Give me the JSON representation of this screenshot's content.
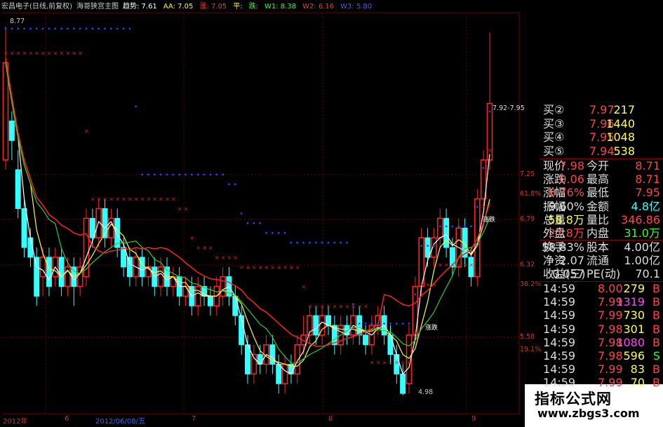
{
  "header": {
    "title": "宏昌电子(日线,前复权)",
    "indicator_name": "海哥狭宫主图",
    "items": [
      {
        "label": "趋势: 7.61",
        "color": "#ffffff"
      },
      {
        "label": "AA: 7.05",
        "color": "#ffff00"
      },
      {
        "label": "涨: 7.05",
        "color": "#ff3333"
      },
      {
        "label": "平:",
        "color": "#ffff00"
      },
      {
        "label": "跌:",
        "color": "#33ff33"
      },
      {
        "label": "W1: 8.38",
        "color": "#33ff33"
      },
      {
        "label": "W2: 6.16",
        "color": "#ff3333"
      },
      {
        "label": "W3: 5.80",
        "color": "#3366ff"
      }
    ]
  },
  "chart": {
    "high_label": "8.77",
    "low_label": "4.98",
    "range_label": "7.92-7.95",
    "annotation_1": "涨跌",
    "annotation_2": "涨跌",
    "y_labels": [
      {
        "text": "7.25",
        "price": 7.25
      },
      {
        "text": "61.8%",
        "price": 7.05
      },
      {
        "text": "6.79",
        "price": 6.79
      },
      {
        "text": "6.32",
        "price": 6.32
      },
      {
        "text": "38.2%",
        "price": 6.12
      },
      {
        "text": "5.58",
        "price": 5.58
      },
      {
        "text": "19.1%",
        "price": 5.45
      }
    ],
    "x_labels": [
      {
        "text": "2012年",
        "color": "#cc3333"
      },
      {
        "text": "6",
        "color": "#cc3333"
      },
      {
        "text": "2012/06/08/五",
        "color": "#3366ff"
      },
      {
        "text": "7",
        "color": "#cc3333"
      },
      {
        "text": "8",
        "color": "#cc3333"
      },
      {
        "text": "9",
        "color": "#cc3333"
      }
    ]
  },
  "quote_panel": {
    "orders": [
      {
        "label": "买②",
        "price": "7.97",
        "vol": "217"
      },
      {
        "label": "买③",
        "price": "7.96",
        "vol": "1440"
      },
      {
        "label": "买④",
        "price": "7.95",
        "vol": "1048"
      },
      {
        "label": "买⑤",
        "price": "7.94",
        "vol": "538"
      }
    ],
    "stats": [
      {
        "l1": "现价",
        "v1": "7.98",
        "l2": "今开",
        "v2": "8.71"
      },
      {
        "l1": "涨跌",
        "v1": "0.06",
        "l2": "最高",
        "v2": "8.71"
      },
      {
        "l1": "涨幅",
        "v1": "0.76%",
        "l2": "最低",
        "v2": "7.95"
      },
      {
        "l1": "振幅",
        "v1": "9.60%",
        "l2": "金额",
        "v2": "4.8亿"
      },
      {
        "l1": "总量",
        "v1": "58.8万",
        "l2": "量比",
        "v2": "346.86"
      },
      {
        "l1": "外盘",
        "v1": "27.8万",
        "l2": "内盘",
        "v2": "31.0万"
      }
    ],
    "finance": [
      {
        "l1": "换手",
        "v1": "58.83%",
        "l2": "股本",
        "v2": "4.00亿"
      },
      {
        "l1": "净资",
        "v1": "2.07",
        "l2": "流通",
        "v2": "1.00亿"
      },
      {
        "l1": "收益(三)",
        "v1": "0.057",
        "l2": "PE(动)",
        "v2": "70.1"
      }
    ],
    "ticks": [
      {
        "time": "14:59",
        "price": "8.00",
        "vol": "279",
        "side": "B"
      },
      {
        "time": "14:59",
        "price": "7.99",
        "vol": "1319",
        "side": "B"
      },
      {
        "time": "14:59",
        "price": "7.99",
        "vol": "730",
        "side": "B"
      },
      {
        "time": "14:59",
        "price": "7.98",
        "vol": "301",
        "side": "B"
      },
      {
        "time": "14:59",
        "price": "7.98",
        "vol": "1080",
        "side": "B"
      },
      {
        "time": "14:59",
        "price": "7.98",
        "vol": "596",
        "side": "S"
      },
      {
        "time": "14:59",
        "price": "7.99",
        "vol": "83",
        "side": "B"
      },
      {
        "time": "14:59",
        "price": "7.99",
        "vol": "70",
        "side": "B"
      }
    ]
  },
  "watermark": {
    "brand": "指标公式网",
    "url": "www.zbgs3.com"
  },
  "colors": {
    "up": "#ff2222",
    "down": "#33ffff",
    "grid": "#6b0000",
    "ma_white": "#ffffff",
    "ma_yellow": "#ffff33",
    "ma_green": "#33cc33",
    "ma_red": "#ff2222",
    "dots_blue": "#2244ff",
    "cross_red": "#cc2222"
  }
}
